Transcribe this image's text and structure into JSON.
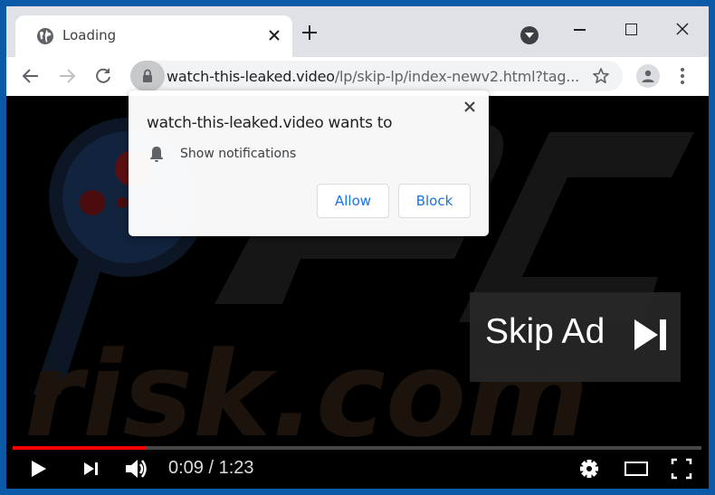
{
  "browser": {
    "tab": {
      "title": "Loading",
      "icon": "globe-icon"
    },
    "new_tab_label": "+",
    "address_bar": {
      "host": "watch-this-leaked.video",
      "path": "/lp/skip-lp/index-newv2.html?tag...",
      "lock_icon": "lock-icon"
    },
    "icons": {
      "back": "arrow-left-icon",
      "forward": "arrow-right-icon",
      "reload": "reload-icon",
      "bookmark": "star-icon",
      "profile": "person-icon",
      "menu": "kebab-menu-icon",
      "tab_search": "chevron-down-circle-icon"
    },
    "colors": {
      "frame": "#0b5aa8",
      "tabstrip": "#dee1e6",
      "accent_link": "#1a73e8"
    }
  },
  "permission_popup": {
    "heading": "watch-this-leaked.video wants to",
    "permission": "Show notifications",
    "allow_label": "Allow",
    "block_label": "Block"
  },
  "video": {
    "skip_ad_label": "Skip Ad",
    "current_time": "0:09",
    "separator": "/",
    "duration": "1:23",
    "progress_fraction": 0.195,
    "progress_color": "#ff0000",
    "watermark_text": "risk.com"
  }
}
